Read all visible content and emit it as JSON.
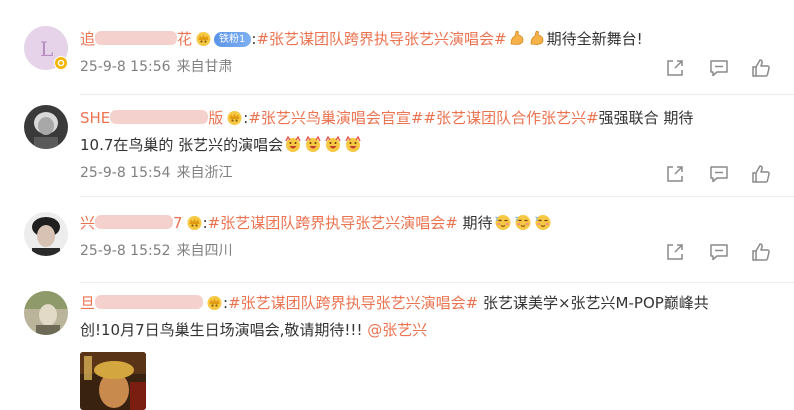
{
  "comments": [
    {
      "user_visible": "追",
      "user_visible_end": "花",
      "fan_badge": "铁粉1",
      "prefix": ":",
      "tags": [
        "#张艺谋团队跨界执导张艺兴演唱会#"
      ],
      "text_after": "期待全新舞台!",
      "emojis": [
        "flex-arm",
        "flex-arm"
      ],
      "time": "25-9-8 15:56",
      "location": "来自甘肃"
    },
    {
      "user_visible": "SHE",
      "user_visible_end": "版",
      "prefix": ":",
      "tags": [
        "#张艺兴鸟巢演唱会官宣#",
        "#张艺谋团队合作张艺兴#"
      ],
      "text_after": "强强联合 期待",
      "text_line2": "10.7在鸟巢的 张艺兴的演唱会",
      "emojis": [
        "cheer-face",
        "cheer-face",
        "cheer-face",
        "cheer-face"
      ],
      "time": "25-9-8 15:54",
      "location": "来自浙江"
    },
    {
      "user_visible": "兴",
      "user_visible_end": "7",
      "prefix": ":",
      "tags": [
        "#张艺谋团队跨界执导张艺兴演唱会#"
      ],
      "text_after": " 期待",
      "emojis": [
        "blushing-face",
        "blushing-face",
        "blushing-face"
      ],
      "time": "25-9-8 15:52",
      "location": "来自四川"
    },
    {
      "user_visible": "旦",
      "prefix": ":",
      "tags": [
        "#张艺谋团队跨界执导张艺兴演唱会#"
      ],
      "text_after": " 张艺谋美学×张艺兴M-POP巅峰共",
      "text_line2": "创!10月7日鸟巢生日场演唱会,敬请期待!!! ",
      "mention": "@张艺兴"
    }
  ],
  "actions": {
    "share_icon": "share-icon",
    "comment_icon": "comment-icon",
    "like_icon": "thumbs-up-icon"
  },
  "colors": {
    "link": "#eb7350",
    "meta": "#808080",
    "icon": "#8a8a8a"
  }
}
